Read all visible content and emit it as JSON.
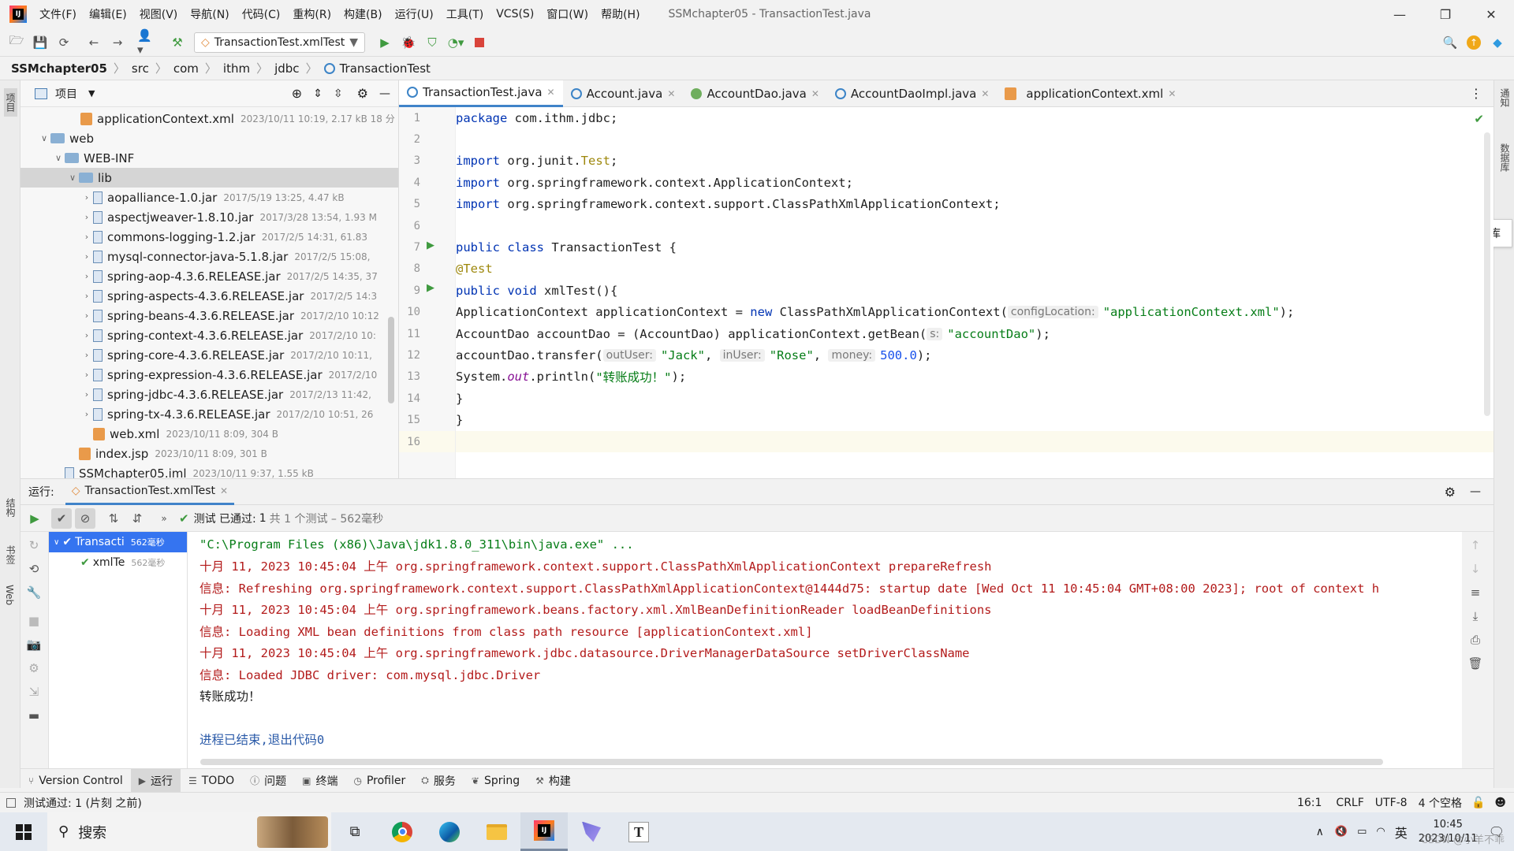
{
  "window": {
    "title": "SSMchapter05 - TransactionTest.java",
    "menu": [
      "文件(F)",
      "编辑(E)",
      "视图(V)",
      "导航(N)",
      "代码(C)",
      "重构(R)",
      "构建(B)",
      "运行(U)",
      "工具(T)",
      "VCS(S)",
      "窗口(W)",
      "帮助(H)"
    ]
  },
  "toolbar": {
    "run_config": "TransactionTest.xmlTest"
  },
  "breadcrumb": [
    "SSMchapter05",
    "src",
    "com",
    "ithm",
    "jdbc",
    "TransactionTest"
  ],
  "project": {
    "header": "项目",
    "rows": [
      {
        "name": "applicationContext.xml",
        "meta": "2023/10/11 10:19, 2.17 kB 18 分",
        "indent": 60,
        "kind": "xml",
        "arrow": ""
      },
      {
        "name": "web",
        "meta": "",
        "indent": 22,
        "kind": "folder",
        "arrow": "∨"
      },
      {
        "name": "WEB-INF",
        "meta": "",
        "indent": 40,
        "kind": "folder",
        "arrow": "∨"
      },
      {
        "name": "lib",
        "meta": "",
        "indent": 58,
        "kind": "folder",
        "arrow": "∨",
        "selected": true
      },
      {
        "name": "aopalliance-1.0.jar",
        "meta": "2017/5/19 13:25, 4.47 kB",
        "indent": 76,
        "kind": "jar",
        "arrow": "›"
      },
      {
        "name": "aspectjweaver-1.8.10.jar",
        "meta": "2017/3/28 13:54, 1.93 M",
        "indent": 76,
        "kind": "jar",
        "arrow": "›"
      },
      {
        "name": "commons-logging-1.2.jar",
        "meta": "2017/2/5 14:31, 61.83",
        "indent": 76,
        "kind": "jar",
        "arrow": "›"
      },
      {
        "name": "mysql-connector-java-5.1.8.jar",
        "meta": "2017/2/5 15:08,",
        "indent": 76,
        "kind": "jar",
        "arrow": "›"
      },
      {
        "name": "spring-aop-4.3.6.RELEASE.jar",
        "meta": "2017/2/5 14:35, 37",
        "indent": 76,
        "kind": "jar",
        "arrow": "›"
      },
      {
        "name": "spring-aspects-4.3.6.RELEASE.jar",
        "meta": "2017/2/5 14:3",
        "indent": 76,
        "kind": "jar",
        "arrow": "›"
      },
      {
        "name": "spring-beans-4.3.6.RELEASE.jar",
        "meta": "2017/2/10 10:12",
        "indent": 76,
        "kind": "jar",
        "arrow": "›"
      },
      {
        "name": "spring-context-4.3.6.RELEASE.jar",
        "meta": "2017/2/10 10:",
        "indent": 76,
        "kind": "jar",
        "arrow": "›"
      },
      {
        "name": "spring-core-4.3.6.RELEASE.jar",
        "meta": "2017/2/10 10:11,",
        "indent": 76,
        "kind": "jar",
        "arrow": "›"
      },
      {
        "name": "spring-expression-4.3.6.RELEASE.jar",
        "meta": "2017/2/10",
        "indent": 76,
        "kind": "jar",
        "arrow": "›"
      },
      {
        "name": "spring-jdbc-4.3.6.RELEASE.jar",
        "meta": "2017/2/13 11:42,",
        "indent": 76,
        "kind": "jar",
        "arrow": "›"
      },
      {
        "name": "spring-tx-4.3.6.RELEASE.jar",
        "meta": "2017/2/10 10:51, 26",
        "indent": 76,
        "kind": "jar",
        "arrow": "›"
      },
      {
        "name": "web.xml",
        "meta": "2023/10/11 8:09, 304 B",
        "indent": 76,
        "kind": "xml",
        "arrow": ""
      },
      {
        "name": "index.jsp",
        "meta": "2023/10/11 8:09, 301 B",
        "indent": 58,
        "kind": "xml",
        "arrow": ""
      },
      {
        "name": "SSMchapter05.iml",
        "meta": "2023/10/11 9:37, 1.55 kB",
        "indent": 40,
        "kind": "iml",
        "arrow": ""
      }
    ]
  },
  "editor": {
    "tabs": [
      {
        "label": "TransactionTest.java",
        "icon": "class-icon",
        "active": true
      },
      {
        "label": "Account.java",
        "icon": "class-icon",
        "active": false
      },
      {
        "label": "AccountDao.java",
        "icon": "interface-icon",
        "active": false
      },
      {
        "label": "AccountDaoImpl.java",
        "icon": "class-icon",
        "active": false
      },
      {
        "label": "applicationContext.xml",
        "icon": "xml-icon",
        "active": false
      }
    ],
    "line_numbers": [
      "1",
      "2",
      "3",
      "4",
      "5",
      "6",
      "7",
      "8",
      "9",
      "10",
      "11",
      "12",
      "13",
      "14",
      "15",
      "16"
    ]
  },
  "code": {
    "l1_kw": "package",
    "l1_rest": " com.ithm.jdbc;",
    "l3_kw": "import",
    "l3_rest": " org.junit.",
    "l3_ann": "Test",
    "l3_end": ";",
    "l4_kw": "import",
    "l4_rest": " org.springframework.context.ApplicationContext;",
    "l5_kw": "import",
    "l5_rest": " org.springframework.context.support.ClassPathXmlApplicationContext;",
    "l7_kw": "public class",
    "l7_rest": " TransactionTest {",
    "l8_ann": "@Test",
    "l9_kw": "public void",
    "l9_rest": " xmlTest(){",
    "l10_a": "ApplicationContext applicationContext = ",
    "l10_kw": "new",
    "l10_b": " ClassPathXmlApplicationContext(",
    "l10_hint": "configLocation:",
    "l10_str": "\"applicationContext.xml\"",
    "l10_end": ");",
    "l11_a": "AccountDao accountDao = (AccountDao) applicationContext.getBean(",
    "l11_hint": "s:",
    "l11_str": "\"accountDao\"",
    "l11_end": ");",
    "l12_a": "accountDao.transfer(",
    "l12_hint1": "outUser:",
    "l12_str1": "\"Jack\"",
    "l12_c1": ", ",
    "l12_hint2": "inUser:",
    "l12_str2": "\"Rose\"",
    "l12_c2": ", ",
    "l12_hint3": "money:",
    "l12_num": "500.0",
    "l12_end": ");",
    "l13_a": "System.",
    "l13_it": "out",
    "l13_b": ".println(",
    "l13_str": "\"转账成功！\"",
    "l13_end": ");",
    "l14": "}",
    "l15": "}"
  },
  "run": {
    "label": "运行:",
    "tab": "TransactionTest.xmlTest",
    "status_prefix": "测试 已通过:",
    "status_count": "1",
    "status_suffix": "共 1 个测试 – 562毫秒",
    "tree": [
      {
        "name": "Transacti",
        "time": "562毫秒"
      },
      {
        "name": "xmlTe",
        "time": "562毫秒"
      }
    ],
    "console": [
      {
        "text": "\"C:\\Program Files (x86)\\Java\\jdk1.8.0_311\\bin\\java.exe\" ...",
        "style": "gray"
      },
      {
        "text": "十月 11, 2023 10:45:04 上午 org.springframework.context.support.ClassPathXmlApplicationContext prepareRefresh",
        "style": "red"
      },
      {
        "text": "信息: Refreshing org.springframework.context.support.ClassPathXmlApplicationContext@1444d75: startup date [Wed Oct 11 10:45:04 GMT+08:00 2023]; root of context h",
        "style": "red"
      },
      {
        "text": "十月 11, 2023 10:45:04 上午 org.springframework.beans.factory.xml.XmlBeanDefinitionReader loadBeanDefinitions",
        "style": "red"
      },
      {
        "text": "信息: Loading XML bean definitions from class path resource [applicationContext.xml]",
        "style": "red"
      },
      {
        "text": "十月 11, 2023 10:45:04 上午 org.springframework.jdbc.datasource.DriverManagerDataSource setDriverClassName",
        "style": "red"
      },
      {
        "text": "信息: Loaded JDBC driver: com.mysql.jdbc.Driver",
        "style": "red"
      },
      {
        "text": "转账成功！",
        "style": "norm"
      },
      {
        "text": "",
        "style": "norm"
      },
      {
        "text": "进程已结束,退出代码0",
        "style": "blue"
      }
    ]
  },
  "bottom_tools": [
    {
      "label": "Version Control",
      "active": false
    },
    {
      "label": "运行",
      "active": true
    },
    {
      "label": "TODO",
      "active": false
    },
    {
      "label": "问题",
      "active": false
    },
    {
      "label": "终端",
      "active": false
    },
    {
      "label": "Profiler",
      "active": false
    },
    {
      "label": "服务",
      "active": false
    },
    {
      "label": "Spring",
      "active": false
    },
    {
      "label": "构建",
      "active": false
    }
  ],
  "status": {
    "message": "测试通过: 1 (片刻 之前)",
    "position": "16:1",
    "line_sep": "CRLF",
    "encoding": "UTF-8",
    "indent": "4 个空格"
  },
  "side": {
    "left_top": "项目",
    "left_structure": "结构",
    "left_bookmarks": "书签",
    "left_web": "Web",
    "right_notify": "通知",
    "right_db": "数据库",
    "db_tooltip": "数据库"
  },
  "taskbar": {
    "search": "搜索",
    "time": "10:45",
    "date": "2023/10/11",
    "ime": "英",
    "watermark": "CSDN @小羊不乖"
  },
  "colors": {
    "accent": "#4083c9",
    "pass": "#3f9a3f",
    "stop": "#d9443b",
    "console_info": "#b31b1b"
  }
}
